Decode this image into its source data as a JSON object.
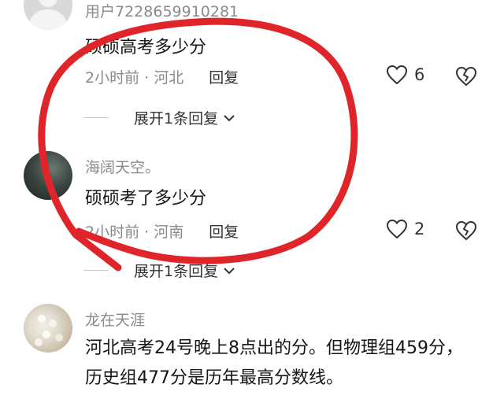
{
  "comments": [
    {
      "username": "用户7228659910281",
      "content": "硕硕高考多少分",
      "time_location": "2小时前 · 河北",
      "reply_label": "回复",
      "likes": "6",
      "expand_label": "展开1条回复"
    },
    {
      "username": "海阔天空。",
      "content": "硕硕考了多少分",
      "time_location": "2小时前 · 河南",
      "reply_label": "回复",
      "likes": "2",
      "expand_label": "展开1条回复"
    },
    {
      "username": "龙在天涯",
      "content": "河北高考24号晚上8点出的分。但物理组459分，历史组477分是历年最高分数线。"
    }
  ],
  "colors": {
    "annotation_circle": "#e0252a",
    "secondary_text": "#8a8a8a"
  },
  "icons": [
    "heart-outline-icon",
    "broken-heart-icon",
    "chevron-down-icon"
  ]
}
